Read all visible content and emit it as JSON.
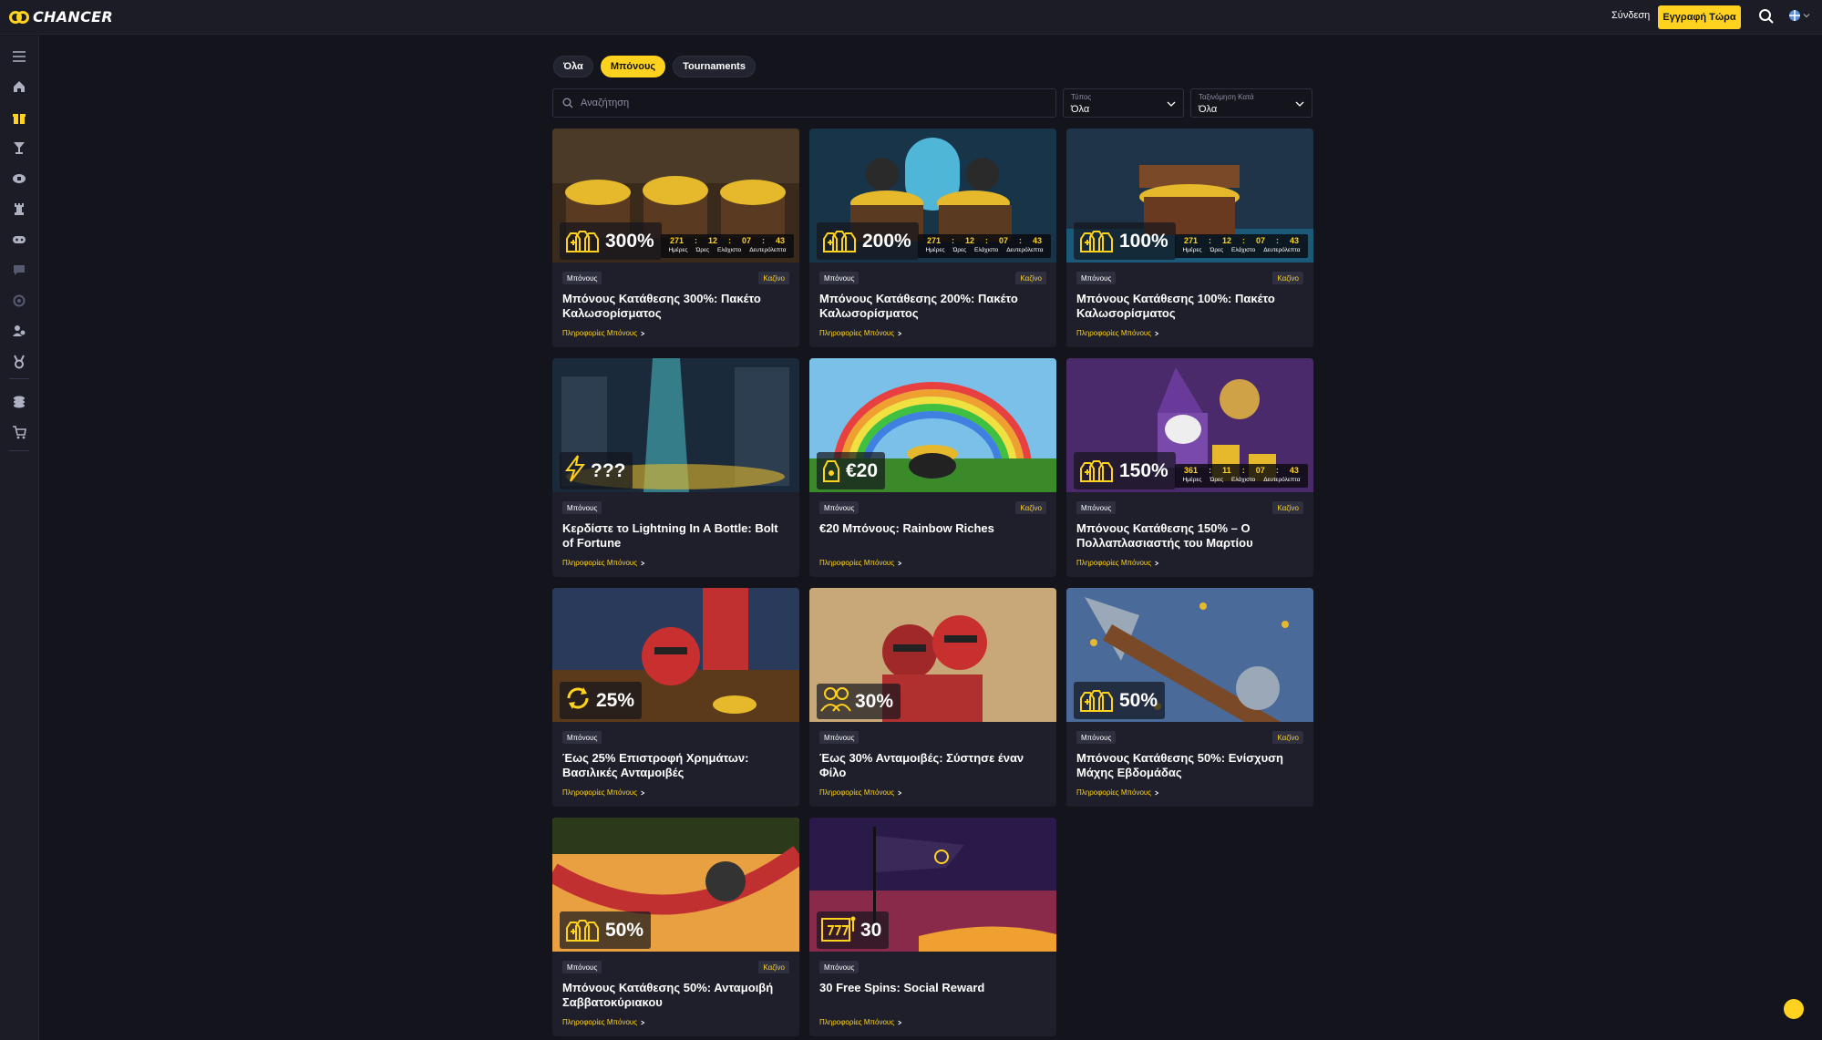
{
  "header": {
    "logo_text": "CHANCER",
    "login_label": "Σύνδεση",
    "signup_label": "Εγγραφή Τώρα"
  },
  "sidebar": {
    "icons": [
      "menu-icon",
      "home-icon",
      "gift-icon",
      "cocktail-icon",
      "tabletennis-icon",
      "rook-icon",
      "gamepad-icon",
      "chat-icon",
      "ring-icon",
      "user-group-icon",
      "medal-icon",
      "coins-icon",
      "cart-icon"
    ]
  },
  "filters": {
    "tabs": [
      {
        "label": "Όλα",
        "active": false
      },
      {
        "label": "Μπόνους",
        "active": true
      },
      {
        "label": "Tournaments",
        "active": false
      }
    ],
    "search_placeholder": "Αναζήτηση",
    "type_label": "Τύπος",
    "type_value": "Όλα",
    "sort_label": "Ταξινόμηση Κατά",
    "sort_value": "Όλα"
  },
  "timer_labels": {
    "days": "Ημέρες",
    "hours": "Ώρες",
    "minutes": "Ελάχιστο",
    "seconds": "Δευτερόλεπτα"
  },
  "cards": [
    {
      "amount": "300%",
      "icon": "money-bags-icon",
      "type": "Μπόνους",
      "category": "Καζίνο",
      "title": "Μπόνους Κατάθεσης 300%: Πακέτο Καλωσορίσματος",
      "link": "Πληροφορίες Μπόνους",
      "timer": [
        "271",
        "12",
        "07",
        "43"
      ],
      "art": "treasure"
    },
    {
      "amount": "200%",
      "icon": "money-bags-icon",
      "type": "Μπόνους",
      "category": "Καζίνο",
      "title": "Μπόνους Κατάθεσης 200%: Πακέτο Καλωσορίσματος",
      "link": "Πληροφορίες Μπόνους",
      "timer": [
        "271",
        "12",
        "07",
        "43"
      ],
      "art": "cave"
    },
    {
      "amount": "100%",
      "icon": "money-bags-icon",
      "type": "Μπόνους",
      "category": "Καζίνο",
      "title": "Μπόνους Κατάθεσης 100%: Πακέτο Καλωσορίσματος",
      "link": "Πληροφορίες Μπόνους",
      "timer": [
        "271",
        "12",
        "07",
        "43"
      ],
      "art": "chest"
    },
    {
      "amount": "???",
      "icon": "lightning-icon",
      "type": "Μπόνους",
      "category": "",
      "title": "Κερδίστε το Lightning In A Bottle: Bolt of Fortune",
      "link": "Πληροφορίες Μπόνους",
      "timer": null,
      "art": "ruins"
    },
    {
      "amount": "€20",
      "icon": "money-bag-icon",
      "type": "Μπόνους",
      "category": "Καζίνο",
      "title": "€20 Μπόνους: Rainbow Riches",
      "link": "Πληροφορίες Μπόνους",
      "timer": null,
      "art": "rainbow"
    },
    {
      "amount": "150%",
      "icon": "money-bags-icon",
      "type": "Μπόνους",
      "category": "Καζίνο",
      "title": "Μπόνους Κατάθεσης 150% – Ο Πολλαπλασιαστής του Μαρτίου",
      "link": "Πληροφορίες Μπόνους",
      "timer": [
        "361",
        "11",
        "07",
        "43"
      ],
      "art": "wizard"
    },
    {
      "amount": "25%",
      "icon": "cashback-icon",
      "type": "Μπόνους",
      "category": "",
      "title": "Έως 25% Επιστροφή Χρημάτων: Βασιλικές Ανταμοιβές",
      "link": "Πληροφορίες Μπόνους",
      "timer": null,
      "art": "knight-banner"
    },
    {
      "amount": "30%",
      "icon": "friends-icon",
      "type": "Μπόνους",
      "category": "",
      "title": "Έως 30% Ανταμοιβές: Σύστησε έναν Φίλο",
      "link": "Πληροφορίες Μπόνους",
      "timer": null,
      "art": "knights"
    },
    {
      "amount": "50%",
      "icon": "money-bags-icon",
      "type": "Μπόνους",
      "category": "Καζίνο",
      "title": "Μπόνους Κατάθεσης 50%: Ενίσχυση Μάχης Εβδομάδας",
      "link": "Πληροφορίες Μπόνους",
      "timer": null,
      "art": "axe"
    },
    {
      "amount": "50%",
      "icon": "money-bags-icon",
      "type": "Μπόνους",
      "category": "Καζίνο",
      "title": "Μπόνους Κατάθεσης 50%: Ανταμοιβή Σαββατοκύριακου",
      "link": "Πληροφορίες Μπόνους",
      "timer": null,
      "art": "hammock"
    },
    {
      "amount": "30",
      "icon": "slot-machine-icon",
      "type": "Μπόνους",
      "category": "",
      "title": "30 Free Spins: Social Reward",
      "link": "Πληροφορίες Μπόνους",
      "timer": null,
      "art": "flag"
    }
  ],
  "colors": {
    "accent": "#ffd21f",
    "background": "#14151c",
    "card": "#1e1f2a"
  }
}
